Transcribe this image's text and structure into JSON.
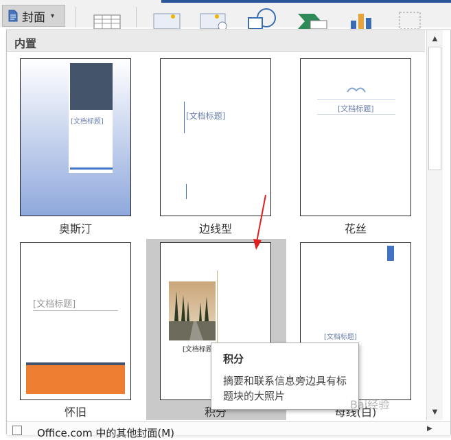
{
  "ribbon": {
    "cover_button_label": "封面",
    "accent_color": "#2b579a"
  },
  "gallery": {
    "section_title": "内置",
    "covers": [
      {
        "name": "奥斯汀",
        "placeholder_title": "[文档标题]"
      },
      {
        "name": "边线型",
        "placeholder_title": "[文档标题]"
      },
      {
        "name": "花丝",
        "placeholder_title": "[文档标题]"
      },
      {
        "name": "怀旧",
        "placeholder_title": "[文档标题]"
      },
      {
        "name": "积分",
        "placeholder_title": "[文档标题]"
      },
      {
        "name": "母线(白)",
        "placeholder_title": "[文档标题]"
      }
    ],
    "selected_index": 4
  },
  "tooltip": {
    "title": "积分",
    "description": "摘要和联系信息旁边具有标题块的大照片"
  },
  "footer": {
    "more_label": "Office.com 中的其他封面(M)"
  },
  "watermark": "Bai经验"
}
